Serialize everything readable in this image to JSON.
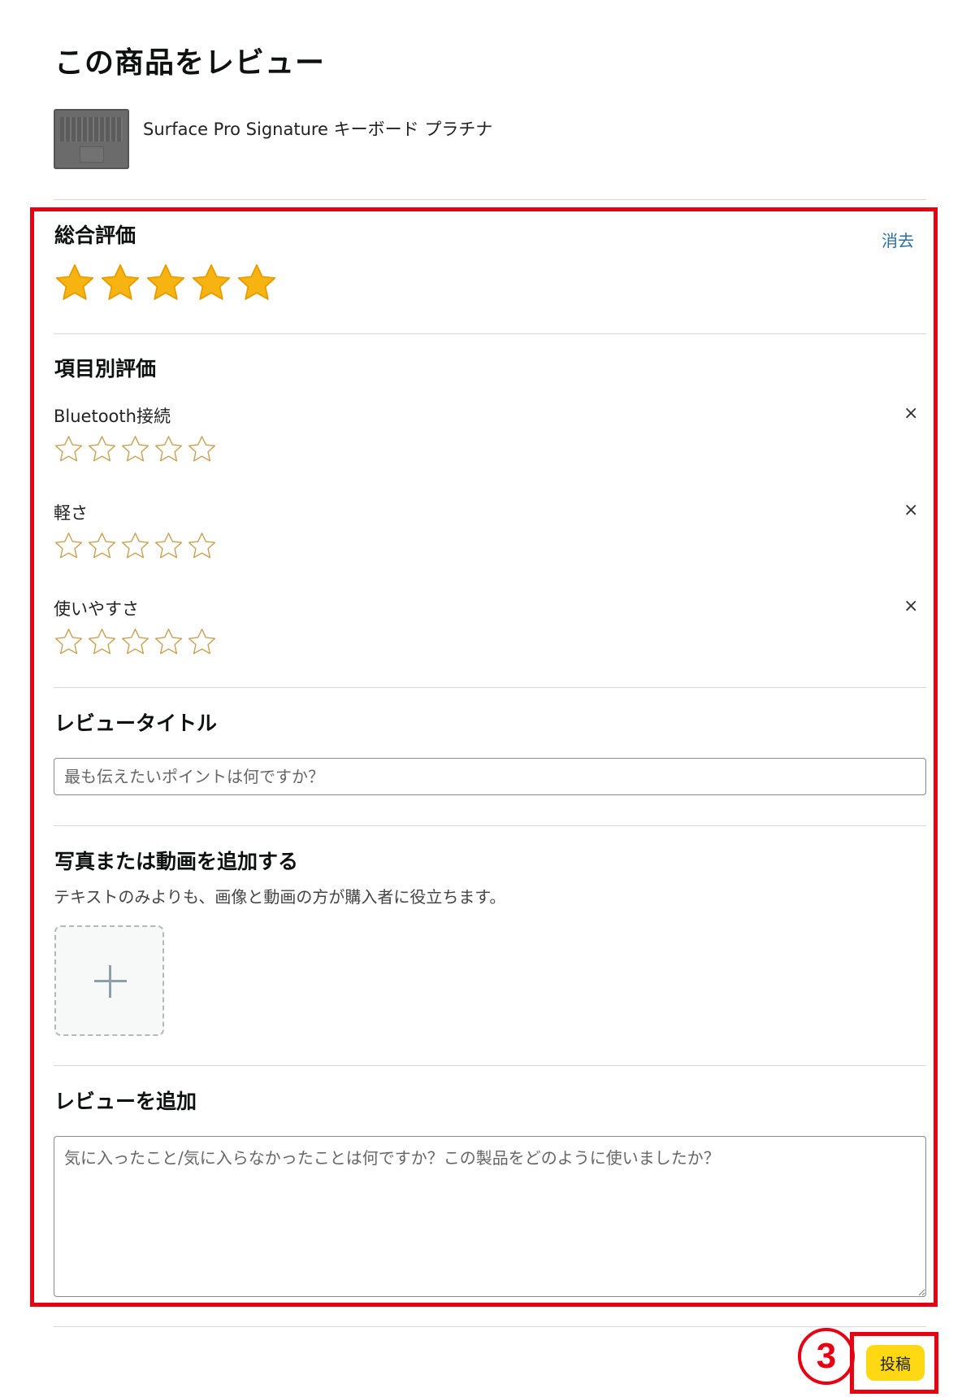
{
  "page": {
    "title": "この商品をレビュー"
  },
  "product": {
    "name": "Surface Pro Signature キーボード プラチナ"
  },
  "overall_rating": {
    "heading": "総合評価",
    "clear_label": "消去",
    "rating": 5,
    "max": 5,
    "filled_color": "#f7b30f"
  },
  "attribute_ratings": {
    "heading": "項目別評価",
    "remove_label": "×",
    "items": [
      {
        "label": "Bluetooth接続",
        "rating": 0,
        "max": 5
      },
      {
        "label": "軽さ",
        "rating": 0,
        "max": 5
      },
      {
        "label": "使いやすさ",
        "rating": 0,
        "max": 5
      }
    ]
  },
  "review_title": {
    "heading": "レビュータイトル",
    "placeholder": "最も伝えたいポイントは何ですか？",
    "value": ""
  },
  "media": {
    "heading": "写真または動画を追加する",
    "subtext": "テキストのみよりも、画像と動画の方が購入者に役立ちます。"
  },
  "review_body": {
    "heading": "レビューを追加",
    "placeholder": "気に入ったこと/気に入らなかったことは何ですか？この製品をどのように使いましたか？",
    "value": ""
  },
  "actions": {
    "submit_label": "投稿"
  },
  "annotation": {
    "step_number": "3",
    "color": "#e60012"
  },
  "colors": {
    "star_fill": "#f7b30f",
    "star_outline": "#c9a053",
    "link": "#2a6ea3",
    "submit_bg": "#ffd814"
  }
}
